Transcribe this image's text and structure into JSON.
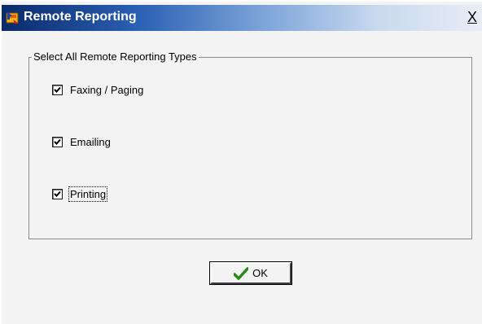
{
  "window": {
    "title": "Remote Reporting",
    "close_label": "X"
  },
  "group": {
    "legend": "Select All Remote Reporting Types",
    "options": [
      {
        "label": "Faxing / Paging",
        "checked": true
      },
      {
        "label": "Emailing",
        "checked": true
      },
      {
        "label": "Printing",
        "checked": true
      }
    ]
  },
  "buttons": {
    "ok_label": "OK"
  },
  "icons": {
    "app": "app-icon",
    "ok": "checkmark-icon"
  },
  "colors": {
    "titlebar_start": "#0a2a6b",
    "titlebar_end": "#e9eef6",
    "checkmark_green": "#2a8a1a"
  }
}
